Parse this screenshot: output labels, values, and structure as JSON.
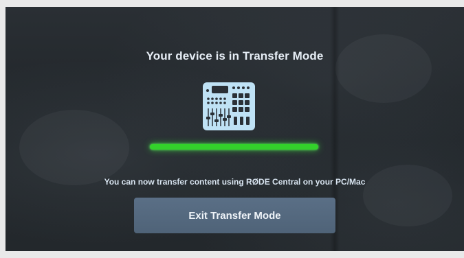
{
  "screen": {
    "title": "Your device is in Transfer Mode",
    "device_icon": "mixer-device-icon",
    "progress": 1.0,
    "progress_color": "#33d12b",
    "message": "You can now transfer content using RØDE Central on your PC/Mac",
    "exit_button_label": "Exit Transfer Mode"
  },
  "colors": {
    "background": "#23282c",
    "icon": "#bfe2f5",
    "button": "#566b81"
  }
}
